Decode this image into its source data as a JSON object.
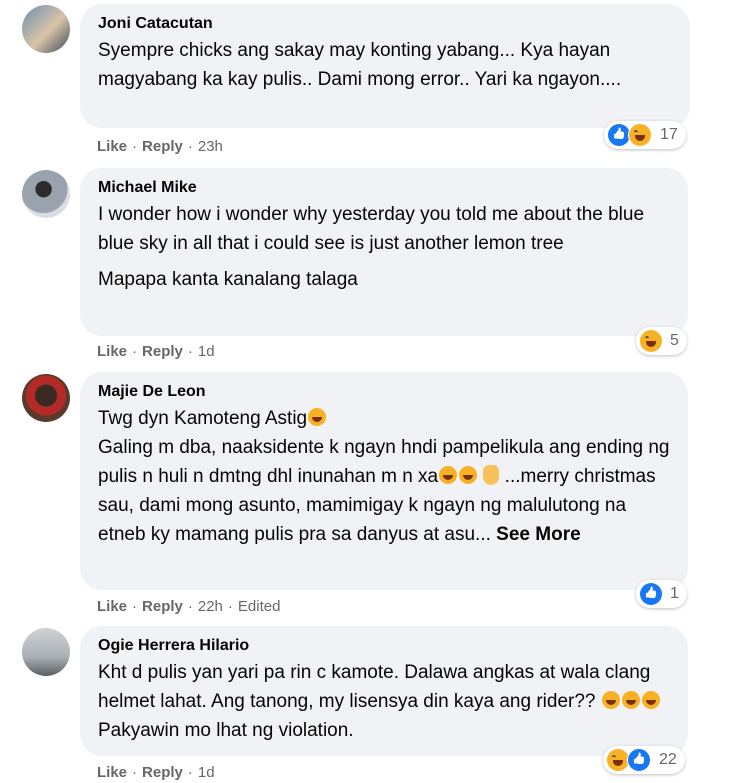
{
  "comments": [
    {
      "author": "Joni Catacutan",
      "paragraphs": [
        "Syempre chicks ang sakay may konting yabang... Kya hayan magyabang ka kay pulis.. Dami mong error.. Yari ka ngayon...."
      ],
      "like_label": "Like",
      "reply_label": "Reply",
      "time": "23h",
      "reaction_count": "17",
      "reaction_icons": [
        "like-icon",
        "haha-icon"
      ]
    },
    {
      "author": "Michael Mike",
      "paragraphs": [
        "I wonder how i wonder why yesterday you told me about the blue blue sky in all that i could see is just another lemon tree",
        "Mapapa kanta kanalang talaga"
      ],
      "like_label": "Like",
      "reply_label": "Reply",
      "time": "1d",
      "reaction_count": "5",
      "reaction_icons": [
        "haha-icon"
      ]
    },
    {
      "author": "Majie De Leon",
      "line1": "Twg dyn Kamoteng Astig",
      "line2": "Galing m dba, naaksidente k ngayn hndi pampelikula ang ending ng pulis n huli n dmtng dhl inunahan m n xa",
      "line3": "...merry christmas sau, dami mong asunto, mamimigay k ngayn ng malulutong na etneb ky mamang pulis pra sa danyus at asu...",
      "see_more": "See More",
      "like_label": "Like",
      "reply_label": "Reply",
      "time": "22h",
      "edited": "Edited",
      "reaction_count": "1",
      "reaction_icons": [
        "like-icon"
      ]
    },
    {
      "author": "Ogie Herrera Hilario",
      "text_a": "Kht d pulis yan yari pa rin c kamote. Dalawa angkas at wala clang helmet lahat. Ang tanong, my lisensya din kaya ang rider??",
      "text_b": "Pakyawin mo lhat ng violation.",
      "like_label": "Like",
      "reply_label": "Reply",
      "time": "1d",
      "reaction_count": "22",
      "reaction_icons": [
        "haha-icon",
        "like-icon"
      ]
    }
  ],
  "colors": {
    "bubble": "#f0f2f5",
    "meta": "#65676b",
    "like": "#1877f2",
    "haha": "#f7b125"
  }
}
